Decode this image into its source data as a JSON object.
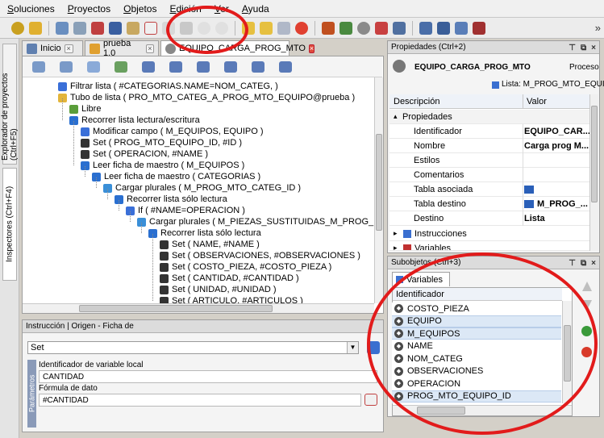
{
  "menu": {
    "items": [
      "Soluciones",
      "Proyectos",
      "Objetos",
      "Edición",
      "Ver",
      "Ayuda"
    ]
  },
  "side_tabs": {
    "explorer": "Explorador de proyectos (Ctrl+F5)",
    "inspectors": "Inspectores (Ctrl+F4)"
  },
  "doc_tabs": [
    {
      "label": "Inicio"
    },
    {
      "label": "prueba 1.0"
    },
    {
      "label": "EQUIPO_CARGA_PROG_MTO"
    }
  ],
  "tree": [
    {
      "text": "Filtrar lista ( #CATEGORIAS.NAME=NOM_CATEG, )",
      "indent": 0,
      "icon": "filter-icon",
      "color": "#3a6fd8"
    },
    {
      "text": "Tubo de lista ( PRO_MTO_CATEG_A_PROG_MTO_EQUIPO@prueba )",
      "indent": 0,
      "icon": "pipe-icon",
      "color": "#e3b53b"
    },
    {
      "text": "Libre",
      "indent": 1,
      "icon": "brush-icon",
      "color": "#5a9e3a"
    },
    {
      "text": "Recorrer lista lectura/escritura",
      "indent": 1,
      "icon": "list-icon",
      "color": "#2a6fd0"
    },
    {
      "text": "Modificar campo ( M_EQUIPOS, EQUIPO )",
      "indent": 2,
      "icon": "field-icon",
      "color": "#3a6fd8"
    },
    {
      "text": "Set ( PROG_MTO_EQUIPO_ID, #ID )",
      "indent": 2,
      "icon": "set-icon",
      "color": "#333"
    },
    {
      "text": "Set ( OPERACION, #NAME )",
      "indent": 2,
      "icon": "set-icon",
      "color": "#333"
    },
    {
      "text": "Leer ficha de maestro ( M_EQUIPOS )",
      "indent": 2,
      "icon": "read-icon",
      "color": "#2a6fd0"
    },
    {
      "text": "Leer ficha de maestro ( CATEGORIAS )",
      "indent": 3,
      "icon": "read-icon",
      "color": "#2a6fd0"
    },
    {
      "text": "Cargar plurales ( M_PROG_MTO_CATEG_ID )",
      "indent": 4,
      "icon": "load-icon",
      "color": "#3a8fd8"
    },
    {
      "text": "Recorrer lista sólo lectura",
      "indent": 5,
      "icon": "list-icon",
      "color": "#2a6fd0"
    },
    {
      "text": "If ( #NAME=OPERACION )",
      "indent": 6,
      "icon": "if-icon",
      "color": "#3a6fd8"
    },
    {
      "text": "Cargar plurales ( M_PIEZAS_SUSTITUIDAS_M_PROG_MTO_CA",
      "indent": 7,
      "icon": "load-icon",
      "color": "#3a8fd8"
    },
    {
      "text": "Recorrer lista sólo lectura",
      "indent": 8,
      "icon": "list-icon",
      "color": "#2a6fd0"
    },
    {
      "text": "Set ( NAME, #NAME )",
      "indent": 9,
      "icon": "set-icon",
      "color": "#333"
    },
    {
      "text": "Set ( OBSERVACIONES, #OBSERVACIONES )",
      "indent": 9,
      "icon": "set-icon",
      "color": "#333"
    },
    {
      "text": "Set ( COSTO_PIEZA, #COSTO_PIEZA )",
      "indent": 9,
      "icon": "set-icon",
      "color": "#333"
    },
    {
      "text": "Set ( CANTIDAD, #CANTIDAD )",
      "indent": 9,
      "icon": "set-icon",
      "color": "#333"
    },
    {
      "text": "Set ( UNIDAD, #UNIDAD )",
      "indent": 9,
      "icon": "set-icon",
      "color": "#333"
    },
    {
      "text": "Set ( ARTICULO, #ARTICULOS )",
      "indent": 9,
      "icon": "set-icon",
      "color": "#333"
    }
  ],
  "instruction_panel": {
    "title": "Instrucción | Origen - Ficha de",
    "selected": "Set",
    "params_label": "Parámetros",
    "var_label": "Identificador de variable local",
    "var_value": "CANTIDAD",
    "formula_label": "Fórmula de dato",
    "formula_value": "#CANTIDAD"
  },
  "properties": {
    "title": "Propiedades (Ctrl+2)",
    "object_name": "EQUIPO_CARGA_PROG_MTO",
    "object_type": "Proceso",
    "list_text": "Lista: M_PROG_MTO_EQUIPO@?",
    "col_desc": "Descripción",
    "col_value": "Valor",
    "group": "Propiedades",
    "rows": [
      {
        "key": "Identificador",
        "value": "EQUIPO_CAR..."
      },
      {
        "key": "Nombre",
        "value": "Carga prog M..."
      },
      {
        "key": "Estilos",
        "value": ""
      },
      {
        "key": "Comentarios",
        "value": ""
      },
      {
        "key": "Tabla asociada",
        "value": ""
      },
      {
        "key": "Tabla destino",
        "value": "M_PROG_..."
      },
      {
        "key": "Destino",
        "value": "Lista"
      }
    ],
    "section_instr": "Instrucciones",
    "section_vars": "Variables"
  },
  "subobjects": {
    "title": "Subobjetos (Ctrl+3)",
    "tab": "Variables",
    "col": "Identificador",
    "items": [
      {
        "name": "COSTO_PIEZA",
        "selected": false
      },
      {
        "name": "EQUIPO",
        "selected": true
      },
      {
        "name": "M_EQUIPOS",
        "selected": true
      },
      {
        "name": "NAME",
        "selected": false
      },
      {
        "name": "NOM_CATEG",
        "selected": false
      },
      {
        "name": "OBSERVACIONES",
        "selected": false
      },
      {
        "name": "OPERACION",
        "selected": false
      },
      {
        "name": "PROG_MTO_EQUIPO_ID",
        "selected": true
      }
    ]
  },
  "colors": {
    "highlight_circle": "#e21b1b",
    "selection": "#dce8f6"
  }
}
